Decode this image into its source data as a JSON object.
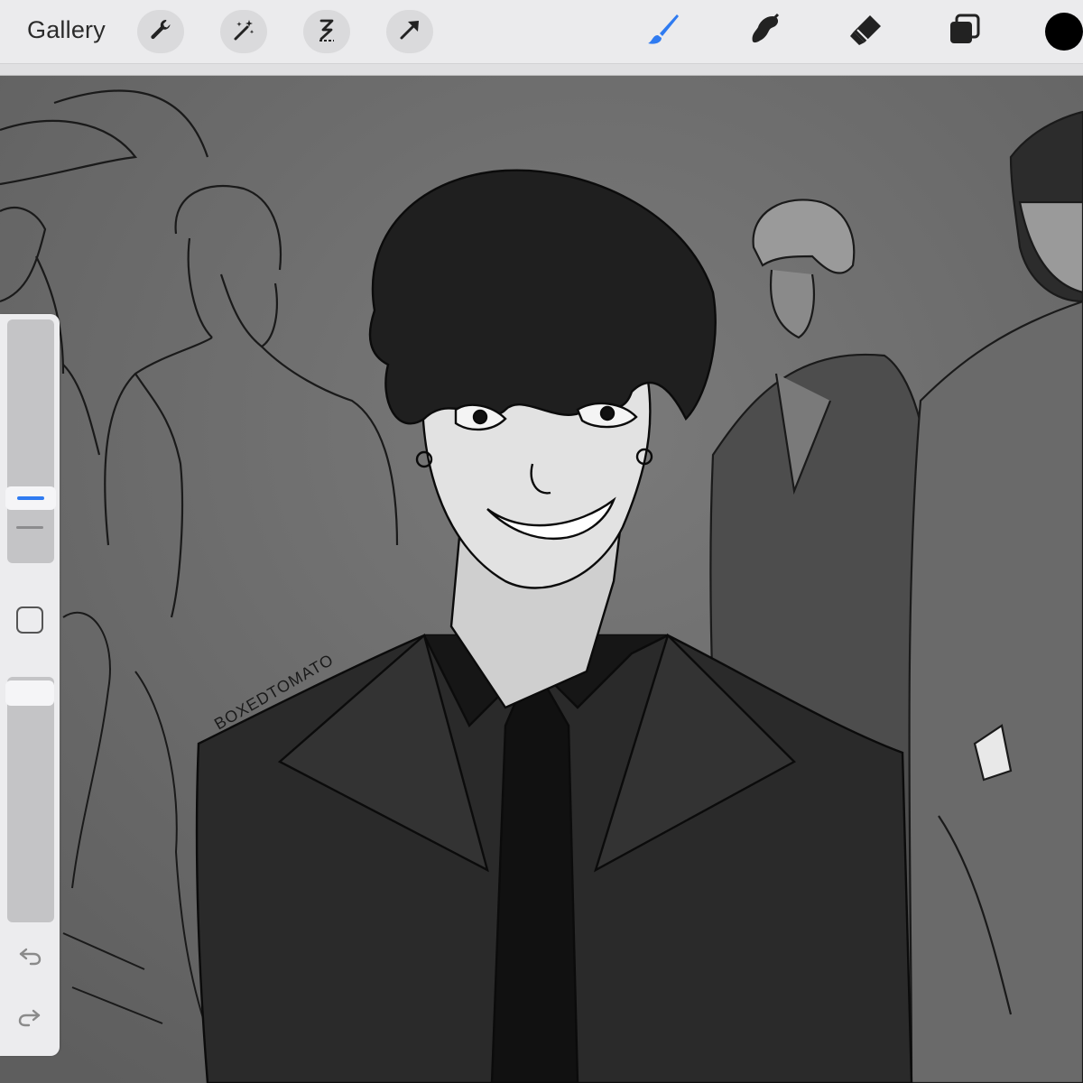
{
  "toolbar": {
    "gallery_label": "Gallery",
    "left_tools": [
      "wrench-icon",
      "magic-wand-icon",
      "selection-s-icon",
      "transform-arrow-icon"
    ],
    "right_tools": [
      "brush-icon",
      "smudge-icon",
      "eraser-icon",
      "layers-icon"
    ],
    "active_tool": "brush-icon",
    "accent_color": "#2f7bf1",
    "current_color": "#000000"
  },
  "sidebar": {
    "brush_size_level": 0.24,
    "opacity_level": 1.0,
    "controls": [
      "brush-size-slider",
      "modify-button",
      "opacity-slider",
      "undo-icon",
      "redo-icon"
    ]
  },
  "canvas": {
    "signature_text": "BOXEDTOMATO",
    "background_color": "#6f6f6f"
  }
}
